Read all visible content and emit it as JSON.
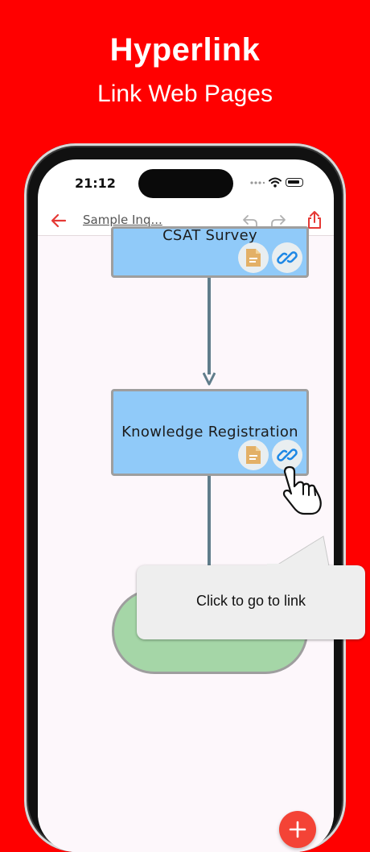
{
  "promo": {
    "headline": "Hyperlink",
    "subline": "Link Web Pages"
  },
  "status_bar": {
    "time": "21:12"
  },
  "toolbar": {
    "doc_title": "Sample Inq..."
  },
  "diagram": {
    "top_node_label": "CSAT Survey",
    "middle_node_label": "Knowledge Registration",
    "end_node_label": ""
  },
  "tooltip": {
    "text": "Click to go to link"
  },
  "colors": {
    "background": "#ff0000",
    "accent": "#e53935",
    "process_node": "#90caf9",
    "terminal_node": "#a5d6a7",
    "connector": "#607d8b",
    "document_icon": "#e3b066",
    "link_icon": "#1e88e5",
    "fab": "#f44336"
  },
  "icons": {
    "back": "arrow-left-icon",
    "undo": "undo-icon",
    "redo": "redo-icon",
    "share": "share-icon",
    "document": "document-icon",
    "link": "link-icon",
    "add": "plus-icon"
  }
}
